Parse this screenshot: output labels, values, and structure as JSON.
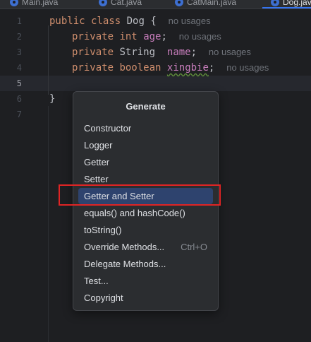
{
  "tabs": [
    {
      "label": "Main.java"
    },
    {
      "label": "Cat.java"
    },
    {
      "label": "CatMain.java"
    },
    {
      "label": "Dog.java"
    }
  ],
  "line_numbers": [
    "1",
    "2",
    "3",
    "4",
    "5",
    "6",
    "7"
  ],
  "current_line": "5",
  "code": {
    "line1": {
      "kw1": "public",
      "kw2": "class",
      "name": "Dog",
      "brace": "{",
      "hint": "no usages"
    },
    "line2": {
      "kw1": "private",
      "type": "int",
      "field": "age",
      "semi": ";",
      "hint": "no usages"
    },
    "line3": {
      "kw1": "private",
      "type": "String",
      "field": "name",
      "semi": ";",
      "hint": "no usages"
    },
    "line4": {
      "kw1": "private",
      "type": "boolean",
      "field": "xingbie",
      "semi": ";",
      "hint": "no usages"
    },
    "line6": {
      "brace": "}"
    }
  },
  "popup": {
    "title": "Generate",
    "items": [
      {
        "label": "Constructor",
        "shortcut": ""
      },
      {
        "label": "Logger",
        "shortcut": ""
      },
      {
        "label": "Getter",
        "shortcut": ""
      },
      {
        "label": "Setter",
        "shortcut": ""
      },
      {
        "label": "Getter and Setter",
        "shortcut": "",
        "selected": true
      },
      {
        "label": "equals() and hashCode()",
        "shortcut": ""
      },
      {
        "label": "toString()",
        "shortcut": ""
      },
      {
        "label": "Override Methods...",
        "shortcut": "Ctrl+O"
      },
      {
        "label": "Delegate Methods...",
        "shortcut": ""
      },
      {
        "label": "Test...",
        "shortcut": ""
      },
      {
        "label": "Copyright",
        "shortcut": ""
      }
    ]
  },
  "colors": {
    "background": "#1e1f22",
    "keyword": "#cf8e6d",
    "field": "#c77dbb",
    "selection": "#2e436e",
    "annotation_box": "#e02424"
  }
}
